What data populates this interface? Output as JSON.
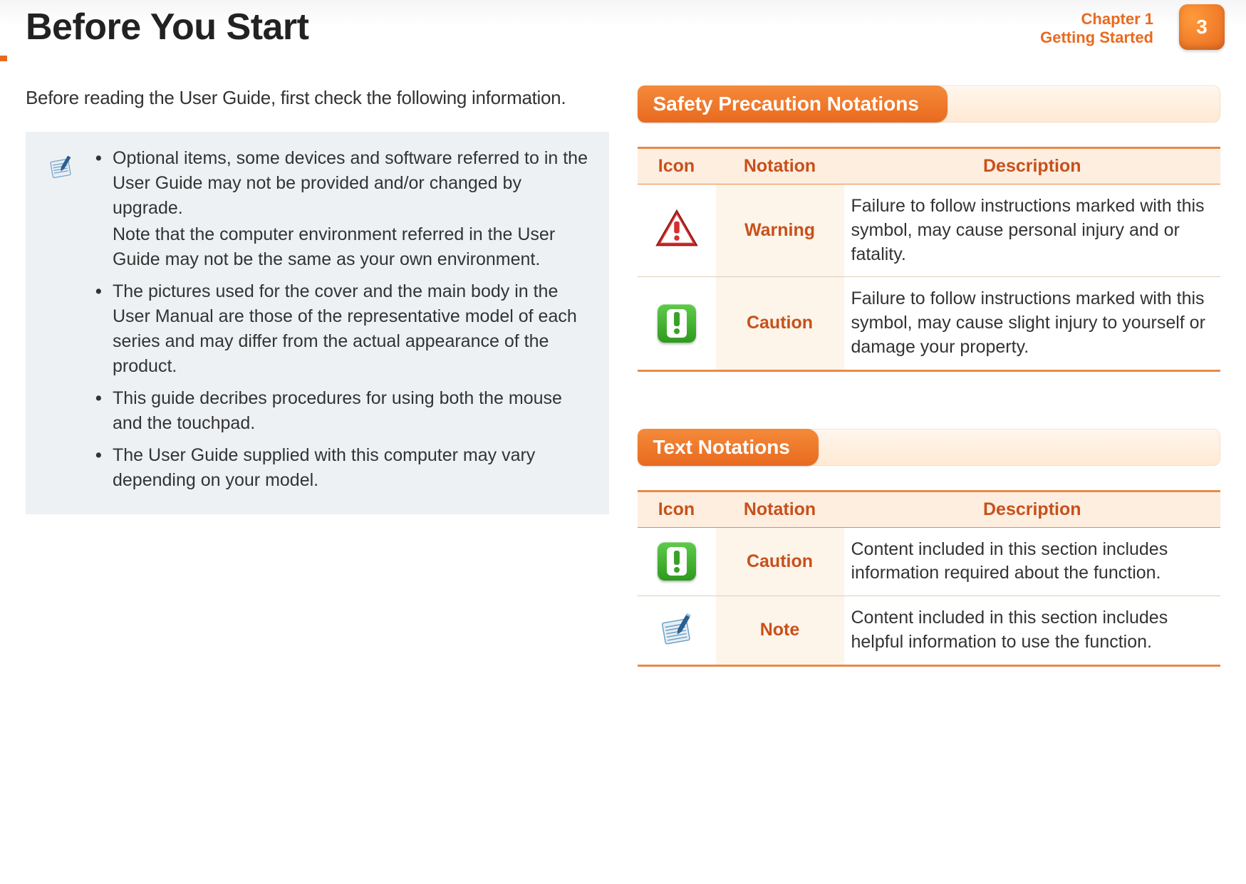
{
  "header": {
    "title": "Before You Start",
    "chapter_line1": "Chapter 1",
    "chapter_line2": "Getting Started",
    "page_number": "3"
  },
  "intro": "Before reading the User Guide, first check the following information.",
  "infobox": {
    "items": [
      {
        "para1": "Optional items, some devices and software referred to in the User Guide may not be provided and/or changed by upgrade.",
        "para2": "Note that the computer environment referred in the User Guide may not be the same as your own environment."
      },
      {
        "para1": "The pictures used for the cover and the main body in the User Manual are those of the representative model of each series and may differ from the actual appearance of the product."
      },
      {
        "para1": "This guide decribes procedures for using both the mouse and the touchpad."
      },
      {
        "para1": "The User Guide supplied with this computer may vary depending on your model."
      }
    ]
  },
  "sections": [
    {
      "title": "Safety Precaution Notations",
      "headers": {
        "icon": "Icon",
        "notation": "Notation",
        "description": "Description"
      },
      "rows": [
        {
          "icon": "warning-icon",
          "notation": "Warning",
          "description": "Failure to follow instructions marked with this symbol, may cause personal injury and or fatality."
        },
        {
          "icon": "caution-icon",
          "notation": "Caution",
          "description": "Failure to follow instructions marked with this symbol, may cause slight injury to yourself or damage your property."
        }
      ]
    },
    {
      "title": "Text Notations",
      "headers": {
        "icon": "Icon",
        "notation": "Notation",
        "description": "Description"
      },
      "rows": [
        {
          "icon": "caution-icon",
          "notation": "Caution",
          "description": "Content included in this section includes information required about the function."
        },
        {
          "icon": "note-icon",
          "notation": "Note",
          "description": "Content included in this section includes helpful information to use the function."
        }
      ]
    }
  ]
}
